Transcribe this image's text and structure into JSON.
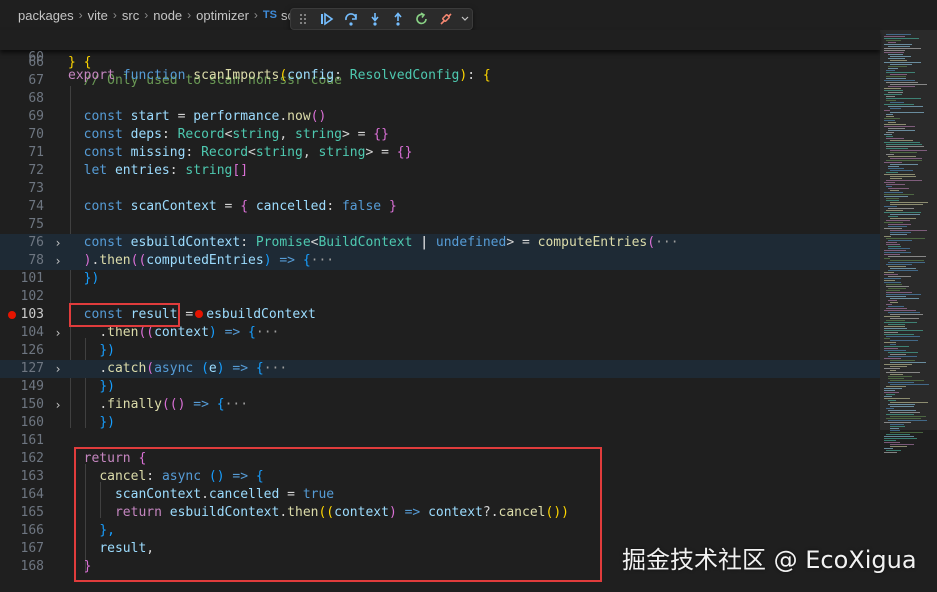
{
  "breadcrumb": {
    "items": [
      "packages",
      "vite",
      "src",
      "node",
      "optimizer"
    ],
    "file_badge": "TS",
    "file_name_partial": "sc"
  },
  "debug_toolbar": {
    "icons": [
      "drag-handle-icon",
      "continue-icon",
      "step-over-icon",
      "step-into-icon",
      "step-out-icon",
      "restart-icon",
      "disconnect-icon",
      "chevron-down-icon"
    ],
    "colors": {
      "action": "#75beff",
      "restart": "#89d185",
      "disconnect": "#f48771"
    }
  },
  "sticky_line": {
    "number": "60",
    "text": "export function scanImports(config: ResolvedConfig): {"
  },
  "line_numbers": [
    "66",
    "67",
    "68",
    "69",
    "70",
    "71",
    "72",
    "73",
    "74",
    "75",
    "76",
    "78",
    "101",
    "102",
    "103",
    "104",
    "126",
    "127",
    "149",
    "150",
    "160",
    "161",
    "162",
    "163",
    "164",
    "165",
    "166",
    "167",
    "168"
  ],
  "code": {
    "l66": "} {",
    "l67": "// Only used to scan non-ssr code",
    "l69": [
      "const",
      "start",
      "=",
      "performance",
      ".",
      "now",
      "()"
    ],
    "l70": [
      "const",
      "deps",
      ":",
      "Record",
      "<",
      "string",
      ",",
      "string",
      ">",
      "=",
      "{}"
    ],
    "l71": [
      "const",
      "missing",
      ":",
      "Record",
      "<",
      "string",
      ",",
      "string",
      ">",
      "=",
      "{}"
    ],
    "l72": [
      "let",
      "entries",
      ":",
      "string",
      "[]"
    ],
    "l74": [
      "const",
      "scanContext",
      "=",
      "{",
      "cancelled",
      ":",
      "false",
      "}"
    ],
    "l76": [
      "const",
      "esbuildContext",
      ":",
      "Promise",
      "<",
      "BuildContext",
      "|",
      "undefined",
      ">",
      "=",
      "computeEntries",
      "(",
      "···"
    ],
    "l78": [
      ")",
      ".",
      "then",
      "((",
      "computedEntries",
      ")",
      "=>",
      "{",
      "···"
    ],
    "l101": "})",
    "l103": [
      "const",
      "result",
      "=",
      "esbuildContext"
    ],
    "l104": [
      ".",
      "then",
      "((",
      "context",
      ")",
      "=>",
      "{",
      "···"
    ],
    "l126": "})",
    "l127": [
      ".",
      "catch",
      "(",
      "async",
      "(",
      "e",
      ")",
      "=>",
      "{",
      "···"
    ],
    "l149": "})",
    "l150": [
      ".",
      "finally",
      "((",
      ")",
      "=>",
      "{",
      "···"
    ],
    "l160": "})",
    "l162": [
      "return",
      "{"
    ],
    "l163": [
      "cancel",
      ":",
      "async",
      "()",
      "=>",
      "{"
    ],
    "l164": [
      "scanContext",
      ".",
      "cancelled",
      "=",
      "true"
    ],
    "l165": [
      "return",
      "esbuildContext",
      ".",
      "then",
      "((",
      "context",
      ")",
      "=>",
      "context",
      "?.",
      "cancel",
      "())"
    ],
    "l166": "},",
    "l167": [
      "result",
      ","
    ],
    "l168": "}"
  },
  "breakpoint_line": "103",
  "watermark": "掘金技术社区 @ EcoXigua",
  "colors": {
    "keyword": "#569cd6",
    "control": "#c586c0",
    "function": "#dcdcaa",
    "variable": "#9cdcfe",
    "type": "#4ec9b0",
    "comment": "#6a9955",
    "breakpoint": "#e51400",
    "annotation_box": "#e03c3c"
  }
}
